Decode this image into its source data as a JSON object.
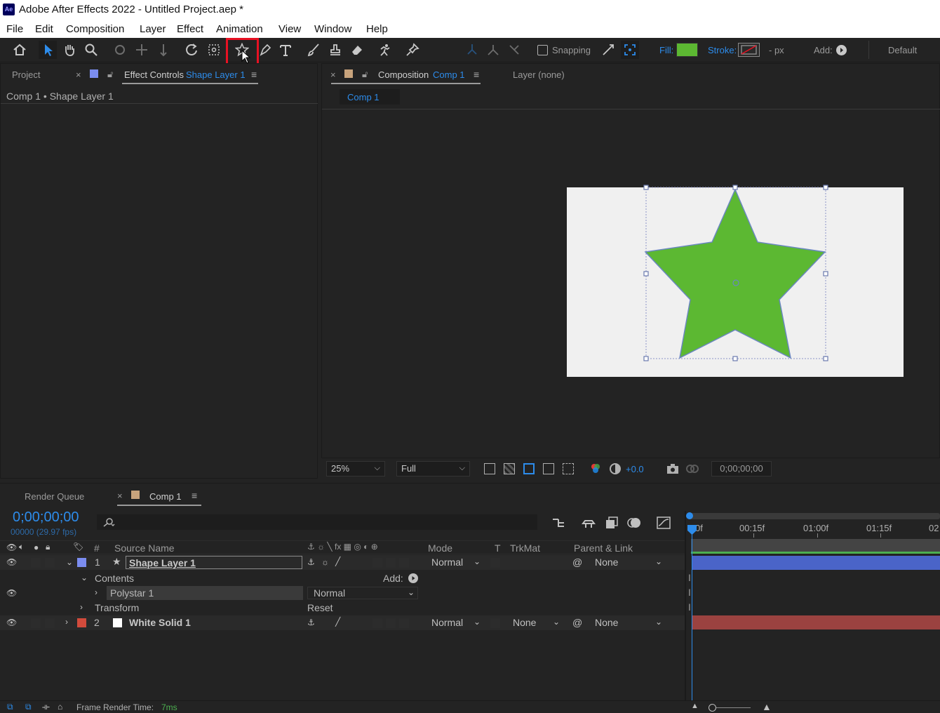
{
  "app": {
    "icon_text": "Ae",
    "window_title": "Adobe After Effects 2022 - Untitled Project.aep *"
  },
  "menu": [
    "File",
    "Edit",
    "Composition",
    "Layer",
    "Effect",
    "Animation",
    "View",
    "Window",
    "Help"
  ],
  "toolbar": {
    "snapping_label": "Snapping",
    "fill_label": "Fill:",
    "fill_color": "#5cb832",
    "stroke_label": "Stroke:",
    "stroke_width": "- px",
    "add_label": "Add:",
    "workspace": "Default"
  },
  "left_panel": {
    "tab_project": "Project",
    "tab_effect_controls": "Effect Controls",
    "tab_effect_layer": "Shape Layer 1",
    "breadcrumb": "Comp 1 • Shape Layer 1"
  },
  "comp_panel": {
    "tab_label": "Composition",
    "tab_comp": "Comp 1",
    "layer_tab": "Layer (none)",
    "subtab": "Comp 1",
    "zoom": "25%",
    "resolution": "Full",
    "exposure": "+0.0",
    "timecode": "0;00;00;00",
    "star_color": "#5cb832"
  },
  "timeline": {
    "tab_render_queue": "Render Queue",
    "tab_comp": "Comp 1",
    "current_time": "0;00;00;00",
    "frame_info": "00000 (29.97 fps)",
    "search_placeholder": "",
    "headers": {
      "num": "#",
      "source_name": "Source Name",
      "mode": "Mode",
      "t": "T",
      "trkmat": "TrkMat",
      "parent": "Parent & Link"
    },
    "ruler": [
      "0f",
      "00:15f",
      "01:00f",
      "01:15f",
      "02"
    ],
    "layers": [
      {
        "num": "1",
        "name": "Shape Layer 1",
        "mode": "Normal",
        "trkmat": "",
        "parent": "None",
        "color": "#7b8df0"
      },
      {
        "num": "2",
        "name": "White Solid 1",
        "mode": "Normal",
        "trkmat": "None",
        "parent": "None",
        "color": "#d24b3c"
      }
    ],
    "contents_label": "Contents",
    "add_label": "Add:",
    "polystar_label": "Polystar 1",
    "polystar_mode": "Normal",
    "transform_label": "Transform",
    "reset_label": "Reset",
    "status_label": "Frame Render Time:",
    "status_value": "7ms"
  }
}
